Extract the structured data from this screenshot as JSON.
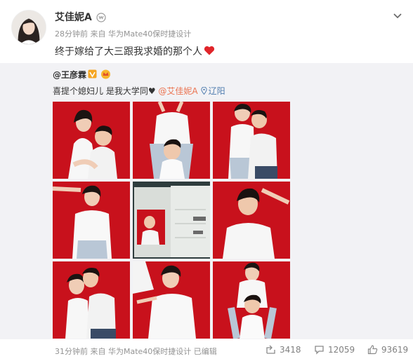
{
  "post": {
    "username": "艾佳妮A",
    "meta": "28分钟前 来自 华为Mate40保时捷设计",
    "content": "终于嫁给了大三跟我求婚的那个人"
  },
  "repost": {
    "username": "@王彦霖",
    "text_main": "喜提个媳妇儿 是我大学同",
    "heart_glyph": "♥",
    "mention": "@艾佳妮A",
    "location": "辽阳",
    "photos": [
      {
        "name": "photo-1",
        "desc": "couple-back-hug"
      },
      {
        "name": "photo-2",
        "desc": "couple-stacked"
      },
      {
        "name": "photo-3",
        "desc": "couple-laughing"
      },
      {
        "name": "photo-4",
        "desc": "woman-posing"
      },
      {
        "name": "photo-5",
        "desc": "marriage-certificate"
      },
      {
        "name": "photo-6",
        "desc": "man-smiling"
      },
      {
        "name": "photo-7",
        "desc": "couple-kiss-cheek"
      },
      {
        "name": "photo-8",
        "desc": "woman-smiling"
      },
      {
        "name": "photo-9",
        "desc": "couple-stacked-2"
      }
    ]
  },
  "footer": {
    "meta": "31分钟前 来自 华为Mate40保时捷设计 已编辑",
    "reposts": "3418",
    "comments": "12059",
    "likes": "93619"
  },
  "colors": {
    "photo_red": "#c8111c",
    "heart_red": "#e0252a",
    "link_orange": "#eb7350",
    "link_blue": "#507daf",
    "repost_bg": "#f2f2f5"
  },
  "icons": [
    "chevron-down-icon",
    "heart-icon",
    "vip-badge-icon",
    "location-icon",
    "repost-icon",
    "comment-icon",
    "like-icon"
  ]
}
